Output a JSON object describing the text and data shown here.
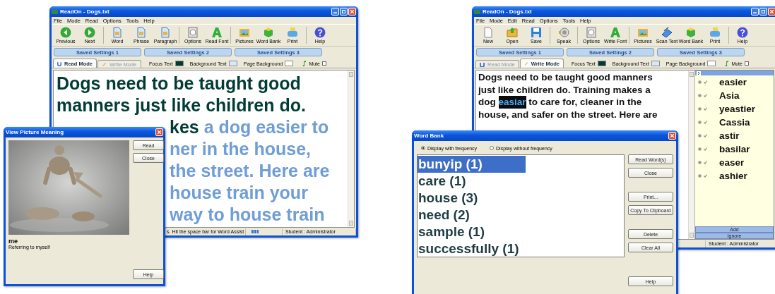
{
  "windows": [
    {
      "kind": "read",
      "title": "ReadOn - Dogs.txt",
      "menu": [
        "File",
        "Mode",
        "Read",
        "Options",
        "Tools",
        "Help"
      ],
      "toolbar": [
        "Previous",
        "Next",
        "Word",
        "Phrase",
        "Paragraph",
        "Options",
        "Read Font",
        "Pictures",
        "Word Bank",
        "Print",
        "Help"
      ],
      "saved_settings": [
        "Saved Settings 1",
        "Saved Settings 2",
        "Saved Settings 3"
      ],
      "tabs": [
        {
          "label": "Read Mode",
          "selected": true
        },
        {
          "label": "Write Mode",
          "selected": false
        }
      ],
      "swatches": [
        {
          "label": "Focus Text",
          "color": "#003c35"
        },
        {
          "label": "Background Text",
          "color": "#d6e8fb"
        },
        {
          "label": "Page Background",
          "color": "#ffffff"
        }
      ],
      "mute": {
        "label": "Mute",
        "checked": false
      },
      "document": {
        "lines": [
          {
            "partly_hidden": false,
            "segments": [
              {
                "text": "Dogs need to be taught good",
                "focus": true
              }
            ]
          },
          {
            "partly_hidden": false,
            "segments": [
              {
                "text": "manners just like children do.",
                "focus": true
              }
            ]
          },
          {
            "partly_hidden": true,
            "segments": [
              {
                "text": "kes",
                "focus": true
              },
              {
                "text": "a dog easier to",
                "focus": false
              }
            ]
          },
          {
            "partly_hidden": true,
            "segments": [
              {
                "text": "ner in the house,",
                "focus": false
              }
            ]
          },
          {
            "partly_hidden": true,
            "segments": [
              {
                "text": "the street. Here are",
                "focus": false
              }
            ]
          },
          {
            "partly_hidden": true,
            "segments": [
              {
                "text": "house train your",
                "focus": false
              }
            ]
          },
          {
            "partly_hidden": true,
            "segments": [
              {
                "text": "way to house train",
                "focus": false
              }
            ]
          }
        ]
      },
      "status_bar": {
        "message": "s. Hit the space bar for Word Assist",
        "user": "Student : Administrator"
      }
    },
    {
      "kind": "write",
      "title": "ReadOn - Dogs.txt",
      "menu": [
        "File",
        "Mode",
        "Edit",
        "Read",
        "Options",
        "Tools",
        "Help"
      ],
      "toolbar": [
        "New",
        "Open",
        "Save",
        "Speak",
        "Options",
        "Write Font",
        "Pictures",
        "Scan Text",
        "Word Bank",
        "Print",
        "Help"
      ],
      "saved_settings": [
        "Saved Settings 1",
        "Saved Settings 2",
        "Saved Settings 3"
      ],
      "tabs": [
        {
          "label": "Read Mode",
          "selected": false
        },
        {
          "label": "Write Mode",
          "selected": true
        }
      ],
      "swatches": [
        {
          "label": "Focus Text",
          "color": "#003c35"
        },
        {
          "label": "Background Text",
          "color": "#d6e8fb"
        },
        {
          "label": "Page Background",
          "color": "#ffffff"
        }
      ],
      "mute": {
        "label": "Mute",
        "checked": false
      },
      "document": {
        "lines": [
          {
            "segments": [
              {
                "text": "Dogs need to be taught good manners",
                "focus": false
              }
            ]
          },
          {
            "segments": [
              {
                "text": "just like children do. Training makes a",
                "focus": false
              }
            ]
          },
          {
            "segments": [
              {
                "text": "dog",
                "focus": false
              },
              {
                "text": "easiar",
                "focus": true
              },
              {
                "text": "to care for, cleaner in the",
                "focus": false
              }
            ]
          },
          {
            "segments": [
              {
                "text": "house, and safer on the street. Here are",
                "focus": false
              }
            ]
          }
        ]
      },
      "suggestions": {
        "items": [
          "easier",
          "Asia",
          "yeastier",
          "Cassia",
          "astir",
          "basilar",
          "easer",
          "ashier"
        ],
        "buttons": [
          "Add",
          "Ignore"
        ]
      },
      "status_bar": {
        "user": "Student : Administrator"
      }
    }
  ],
  "dialogs": [
    {
      "kind": "picture",
      "title": "View Picture Meaning",
      "word": "me",
      "meaning": "Referring to myself",
      "buttons": [
        "Read",
        "Close",
        "Help"
      ]
    },
    {
      "kind": "word_bank",
      "title": "Word Bank",
      "options": [
        {
          "label": "Display with frequency",
          "selected": true
        },
        {
          "label": "Display without frequency",
          "selected": false
        }
      ],
      "words": [
        {
          "text": "bunyip (1)",
          "selected": true
        },
        {
          "text": "care (1)",
          "selected": false
        },
        {
          "text": "house (3)",
          "selected": false
        },
        {
          "text": "need (2)",
          "selected": false
        },
        {
          "text": "sample (1)",
          "selected": false
        },
        {
          "text": "successfully (1)",
          "selected": false
        }
      ],
      "buttons": [
        "Read Word(s)",
        "Close",
        "Print...",
        "Copy To Clipboard",
        "Delete",
        "Clear All",
        "Help"
      ]
    }
  ]
}
